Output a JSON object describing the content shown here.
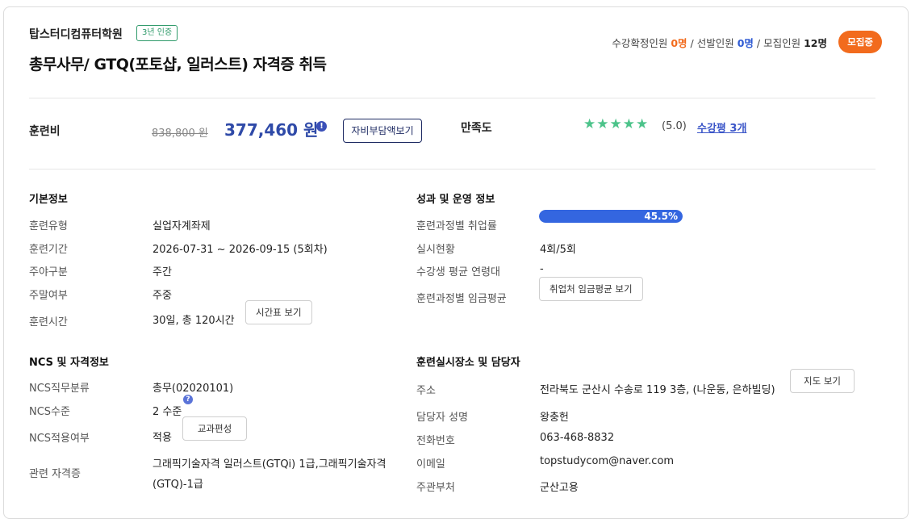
{
  "header": {
    "institute": "탑스터디컴퓨터학원",
    "cert_badge": "3년 인증",
    "course_title": "총무사무/ GTQ(포토샵, 일러스트) 자격증 취득",
    "counts": {
      "confirmed_label": "수강확정인원",
      "confirmed_value": "0명",
      "selected_label": "선발인원",
      "selected_value": "0명",
      "recruit_label": "모집인원",
      "recruit_value": "12명",
      "separator": "/"
    },
    "status_badge": "모집중"
  },
  "fee": {
    "label": "훈련비",
    "original": "838,800 원",
    "price": "377,460 원",
    "info_icon": "!",
    "selfpay_button": "자비부담액보기"
  },
  "satisfaction": {
    "label": "만족도",
    "stars": "★★★★★",
    "rating": "(5.0)",
    "review_link": "수강평 3개",
    "star_color": "#4cc38a"
  },
  "basic": {
    "title": "기본정보",
    "rows": [
      {
        "label": "훈련유형",
        "value": "실업자계좌제"
      },
      {
        "label": "훈련기간",
        "value": "2026-07-31 ~ 2026-09-15 (5회차)"
      },
      {
        "label": "주야구분",
        "value": "주간"
      },
      {
        "label": "주말여부",
        "value": "주중"
      },
      {
        "label": "훈련시간",
        "value": "30일, 총 120시간",
        "button": "시간표 보기"
      }
    ]
  },
  "performance": {
    "title": "성과 및 운영 정보",
    "employment_label": "훈련과정별 취업률",
    "employment_rate": 45.5,
    "employment_text": "45.5%",
    "status_label": "실시현황",
    "status_value": "4회/5회",
    "age_label": "수강생 평균 연령대",
    "age_value": "-",
    "wage_label": "훈련과정별 임금평균",
    "wage_button": "취업처 임금평균 보기",
    "bar_color": "#3466e0"
  },
  "ncs": {
    "title": "NCS 및 자격정보",
    "class_label": "NCS직무분류",
    "class_value": "총무(02020101)",
    "level_label": "NCS수준",
    "level_value": "2 수준",
    "level_icon": "?",
    "apply_label": "NCS적용여부",
    "apply_value": "적용",
    "apply_button": "교과편성",
    "cert_label": "관련 자격증",
    "cert_line1": "그래픽기술자격 일러스트(GTQi) 1급,그래픽기술자격",
    "cert_line2": "(GTQ)-1급"
  },
  "location": {
    "title": "훈련실시장소 및 담당자",
    "address_label": "주소",
    "address_value": "전라북도 군산시 수송로 119 3층, (나운동, 은하빌딩)",
    "map_button": "지도 보기",
    "manager_label": "담당자 성명",
    "manager_value": "왕충헌",
    "phone_label": "전화번호",
    "phone_value": "063-468-8832",
    "email_label": "이메일",
    "email_value": "topstudycom@naver.com",
    "office_label": "주관부처",
    "office_value": "군산고용"
  },
  "colors": {
    "accent_orange": "#f26b1d",
    "accent_blue": "#2f4aa8",
    "cert_green": "#2f9a6a"
  }
}
